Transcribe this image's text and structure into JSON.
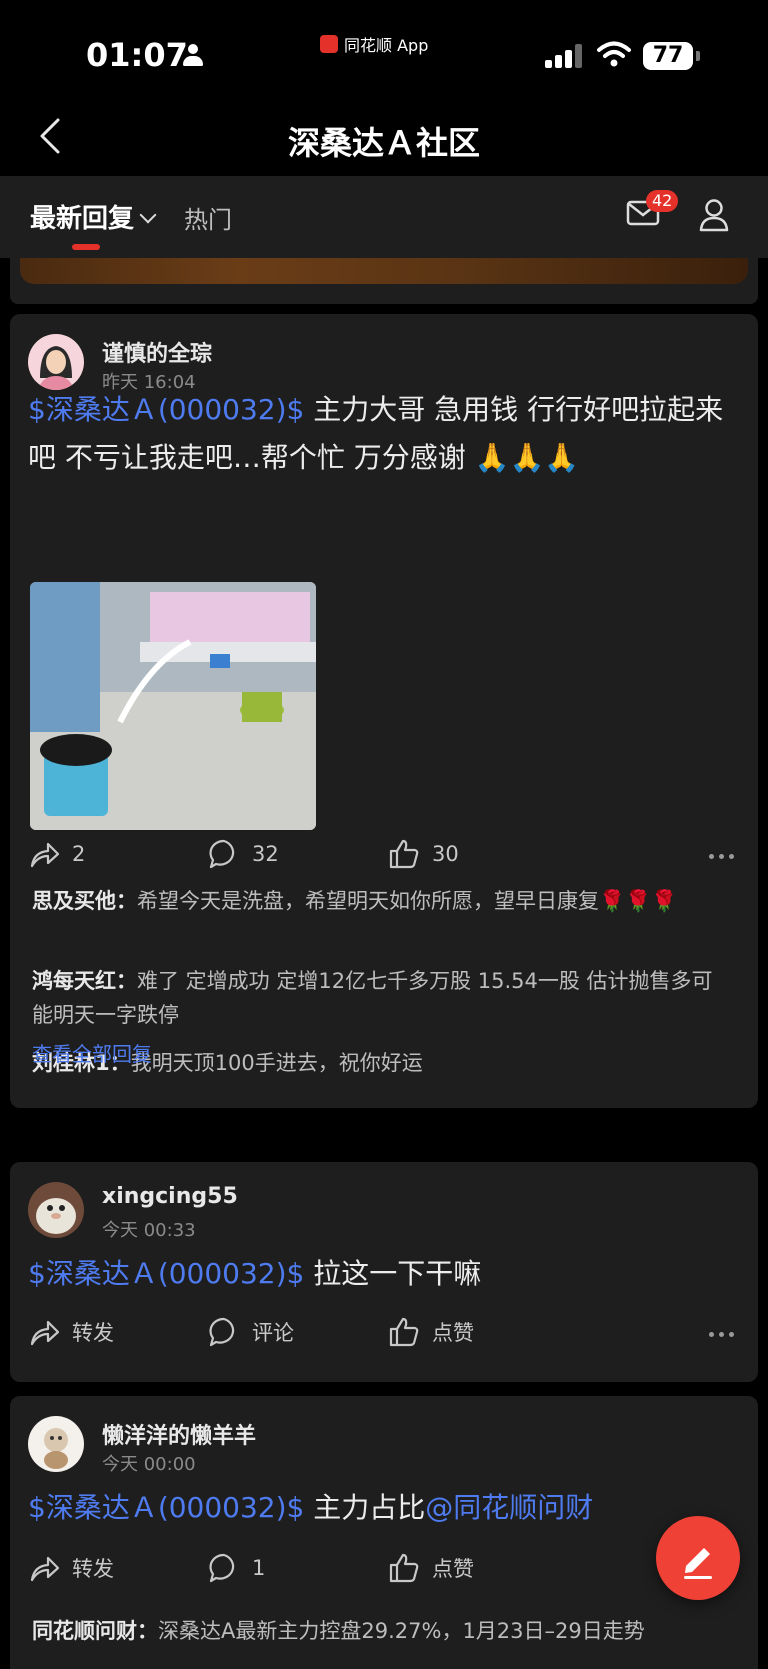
{
  "status_bar": {
    "time": "01:07",
    "app_name": "同花顺 App",
    "battery": "77"
  },
  "header": {
    "title": "深桑达Ａ社区",
    "back_icon": "chevron-left-icon"
  },
  "tabs": {
    "latest": "最新回复",
    "hot": "热门",
    "mail_count": "42"
  },
  "posts": [
    {
      "username": "谨慎的全琮",
      "time": "昨天 16:04",
      "stock_tag": "$深桑达Ａ(000032)$",
      "text": " 主力大哥 急用钱 行行好吧拉起来吧 不亏让我走吧…帮个忙 万分感谢 🙏🙏🙏",
      "has_image": true,
      "share": "2",
      "comment": "32",
      "like": "30",
      "replies": [
        {
          "user": "思及买他：",
          "text": "希望今天是洗盘，希望明天如你所愿，望早日康复🌹🌹🌹"
        },
        {
          "user": "鸿每天红：",
          "text": "难了 定增成功 定增12亿七千多万股 15.54一股 估计抛售多可能明天一字跌停"
        },
        {
          "user": "刘桂林1：",
          "text": "我明天顶100手进去，祝你好运"
        }
      ],
      "view_all": "查看全部回复"
    },
    {
      "username": "xingcing55",
      "time": "今天 00:33",
      "stock_tag": "$深桑达Ａ(000032)$",
      "text": " 拉这一下干嘛",
      "share": "转发",
      "comment": "评论",
      "like": "点赞"
    },
    {
      "username": "懒洋洋的懒羊羊",
      "time": "今天 00:00",
      "stock_tag": "$深桑达Ａ(000032)$",
      "text": " 主力占比",
      "mention": "@同花顺问财",
      "share": "转发",
      "comment": "1",
      "like": "点赞",
      "replies": [
        {
          "user": "同花顺问财：",
          "text": "深桑达A最新主力控盘29.27%，1月23日–29日走势"
        }
      ]
    }
  ],
  "colors": {
    "accent": "#4f7bf0",
    "brand_red": "#e4322b",
    "card_bg": "#1e1e1e"
  }
}
